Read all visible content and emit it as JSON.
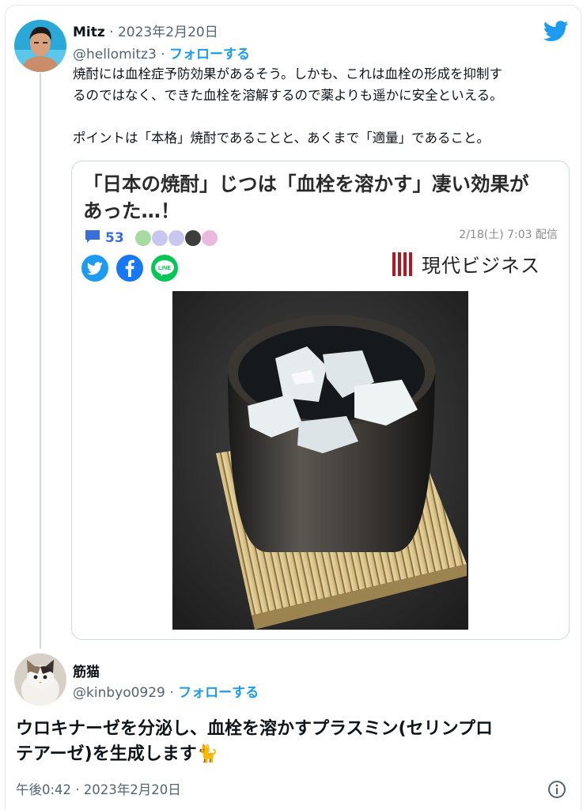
{
  "tweet": {
    "author_name": "Mitz",
    "separator": "·",
    "date": "2023年2月20日",
    "handle": "@hellomitz3",
    "follow_label": "フォローする",
    "text_lines": [
      "焼酎には血栓症予防効果があるそう。しかも、これは血栓の形成を抑制す",
      "るのではなく、できた血栓を溶解するので薬よりも遥かに安全といえる。",
      "",
      "ポイントは「本格」焼酎であることと、あくまで「適量」であること。"
    ]
  },
  "embed": {
    "title_lines": [
      "「日本の焼酎」じつは「血栓を溶かす」凄い効果が",
      "あった…！"
    ],
    "comment_count": "53",
    "delivery": "2/18(土) 7:03 配信",
    "publisher": "現代ビジネス",
    "share_icons": [
      "twitter-share-icon",
      "facebook-share-icon",
      "line-share-icon"
    ],
    "reaction_colors": [
      "#a8dba0",
      "#c9c6ef",
      "#c9c6ef",
      "#3d3d3d",
      "#e9b9df"
    ]
  },
  "reply": {
    "author_name": "筋猫",
    "handle": "@kinbyo0929",
    "separator": "·",
    "follow_label": "フォローする",
    "text_lines": [
      "ウロキナーゼを分泌し、血栓を溶かすプラスミン(セリンプロ",
      "テアーゼ)を生成します🐈"
    ],
    "timestamp": "午後0:42 · 2023年2月20日"
  },
  "colors": {
    "accent": "#1d9bf0",
    "text": "#0f1419",
    "muted": "#536471",
    "border": "#cfd9de",
    "publisher_red": "#b3171f"
  }
}
